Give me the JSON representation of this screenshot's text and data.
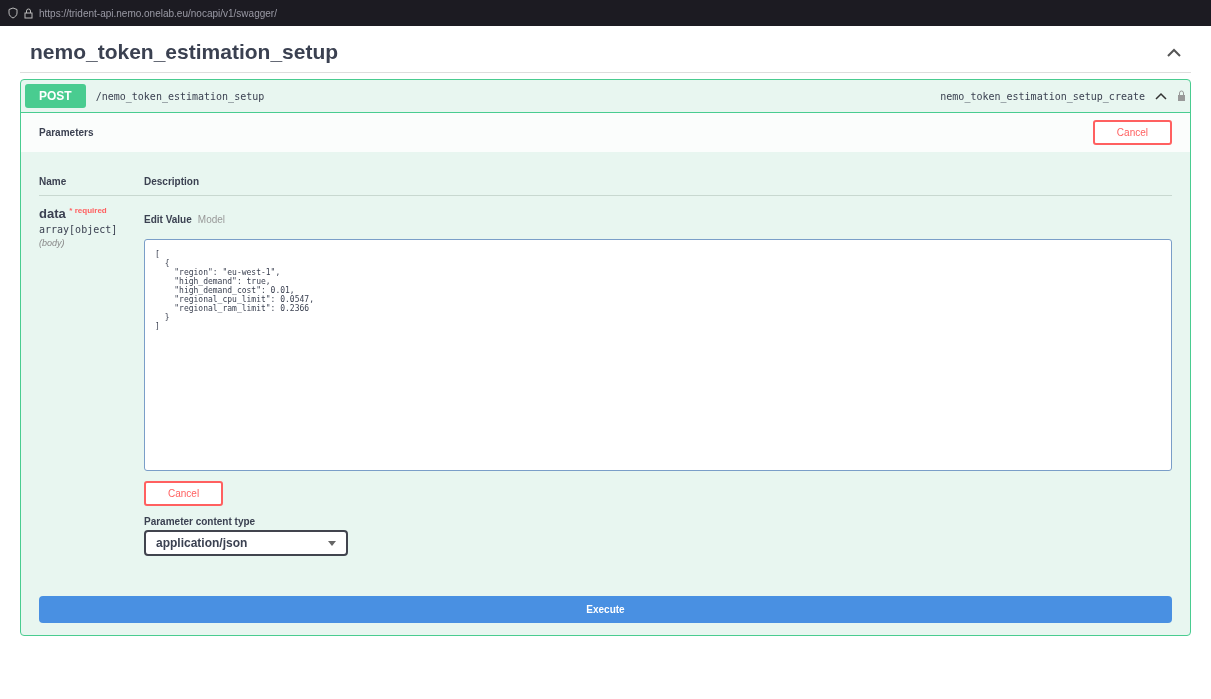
{
  "browser": {
    "url": "https://trident-api.nemo.onelab.eu/nocapi/v1/swagger/"
  },
  "section": {
    "title": "nemo_token_estimation_setup",
    "expanded": true
  },
  "operation": {
    "method": "POST",
    "path": "/nemo_token_estimation_setup",
    "operation_id": "nemo_token_estimation_setup_create",
    "expanded": true
  },
  "parameters": {
    "title": "Parameters",
    "cancel_label": "Cancel",
    "columns": [
      "Name",
      "Description"
    ],
    "items": [
      {
        "name": "data",
        "required_mark": "*",
        "required_label": "required",
        "type": "array[object]",
        "location": "(body)",
        "tabs": [
          {
            "label": "Edit Value",
            "selected": true
          },
          {
            "label": "Model",
            "selected": false
          }
        ],
        "value": "[\n  {\n    \"region\": \"eu-west-1\",\n    \"high_demand\": true,\n    \"high_demand_cost\": 0.01,\n    \"regional_cpu_limit\": 0.0547,\n    \"regional_ram_limit\": 0.2366\n  }\n]",
        "cancel_label": "Cancel"
      }
    ],
    "content_type_label": "Parameter content type",
    "content_type": "application/json"
  },
  "execute_label": "Execute"
}
